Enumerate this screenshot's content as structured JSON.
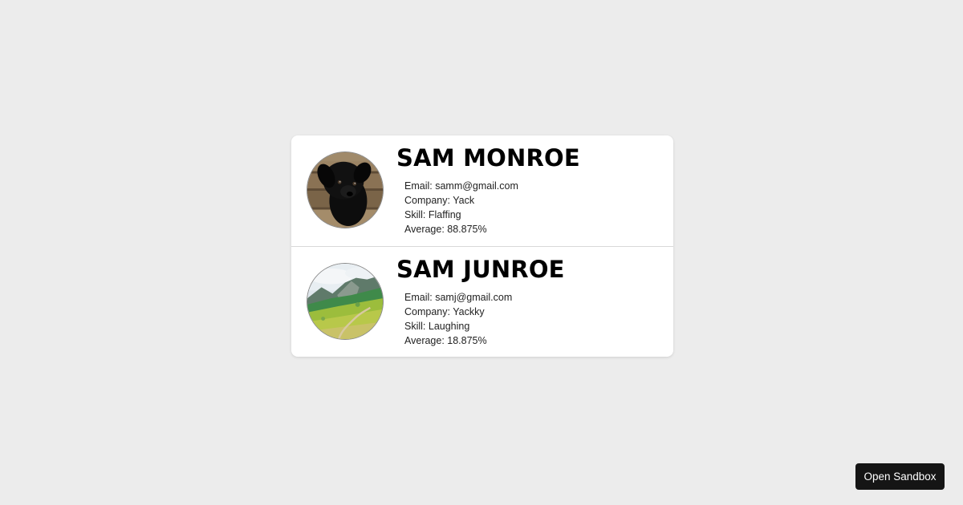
{
  "students": [
    {
      "name": "SAM MONROE",
      "email": "Email: samm@gmail.com",
      "company": "Company: Yack",
      "skill": "Skill: Flaffing",
      "average": "Average: 88.875%",
      "avatar_icon": "dog-photo-icon"
    },
    {
      "name": "SAM JUNROE",
      "email": "Email: samj@gmail.com",
      "company": "Company: Yackky",
      "skill": "Skill: Laughing",
      "average": "Average: 18.875%",
      "avatar_icon": "landscape-photo-icon"
    }
  ],
  "sandbox_button": {
    "label": "Open Sandbox"
  },
  "colors": {
    "background": "#ececec",
    "card": "#ffffff",
    "button": "#151515"
  }
}
